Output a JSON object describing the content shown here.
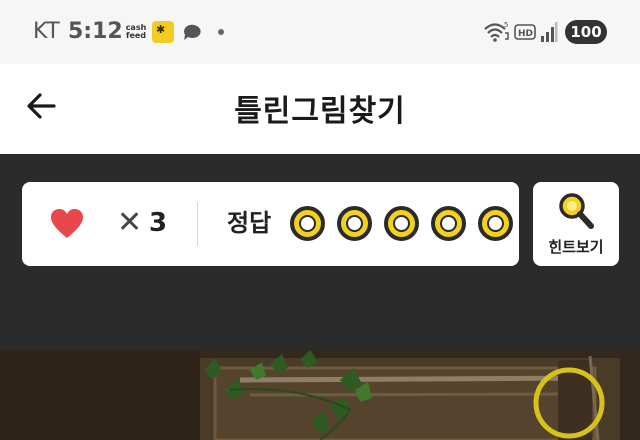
{
  "status_bar": {
    "carrier": "KT",
    "time": "5:12",
    "cash_feed": "cash feed",
    "battery": "100",
    "icons": [
      "kakao-notification-icon",
      "talk-bubble-icon",
      "wifi-icon",
      "hd-icon",
      "signal-icon"
    ]
  },
  "header": {
    "title": "틀린그림찾기",
    "back_icon": "arrow-left"
  },
  "game": {
    "lives_count": "3",
    "times_symbol": "✕",
    "answer_label": "정답",
    "answers_total": 5,
    "answers_found": 0,
    "hint_label": "힌트보기",
    "accent_color": "#f3d21e",
    "heart_color": "#e8474c"
  }
}
